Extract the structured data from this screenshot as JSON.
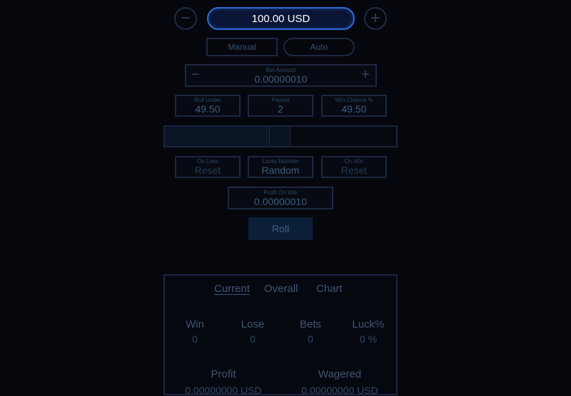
{
  "balance": {
    "value": "100.00 USD",
    "minus_symbol": "−",
    "plus_symbol": "+"
  },
  "modes": [
    {
      "label": "Manual"
    },
    {
      "label": "Auto"
    }
  ],
  "bet": {
    "label": "Bet Amount",
    "value": "0.00000010",
    "minus": "−",
    "plus": "+"
  },
  "fields": {
    "roll_under": {
      "label": "Roll Under",
      "value": "49.50"
    },
    "payout": {
      "label": "Payout",
      "value": "2"
    },
    "win_chance": {
      "label": "Win Chance %",
      "value": "49.50"
    },
    "on_loss": {
      "label": "On Loss",
      "value": "Reset"
    },
    "lucky_number": {
      "label": "Lucky Number",
      "value": "Random"
    },
    "on_win": {
      "label": "On Win",
      "value": "Reset"
    },
    "profit_on_win": {
      "label": "Profit On Win",
      "value": "0.00000010"
    }
  },
  "slider": {
    "fraction": 0.495
  },
  "roll_button": {
    "label": "Roll"
  },
  "stats": {
    "tabs": [
      {
        "label": "Current"
      },
      {
        "label": "Overall"
      },
      {
        "label": "Chart"
      }
    ],
    "win": {
      "label": "Win",
      "value": "0"
    },
    "lose": {
      "label": "Lose",
      "value": "0"
    },
    "bets": {
      "label": "Bets",
      "value": "0"
    },
    "luck": {
      "label": "Luck%",
      "value": "0 %"
    },
    "profit": {
      "label": "Profit",
      "value": "0.00000000 USD"
    },
    "wagered": {
      "label": "Wagered",
      "value": "0.00000000 USD"
    }
  },
  "colors": {
    "accent": "#2e6cd6",
    "background": "#06070d",
    "border": "#1c2742"
  }
}
